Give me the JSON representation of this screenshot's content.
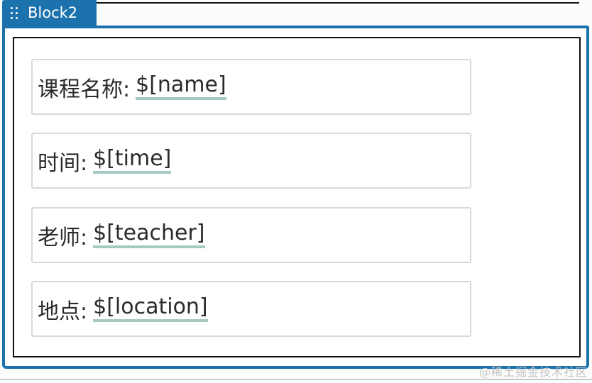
{
  "block": {
    "title": "Block2",
    "grip_icon": "grip-dots-icon",
    "accent_color": "#1b72ad"
  },
  "fields": [
    {
      "label": "课程名称:",
      "value": "$[name]"
    },
    {
      "label": "时间:",
      "value": "$[time]"
    },
    {
      "label": "老师:",
      "value": "$[teacher]"
    },
    {
      "label": "地点:",
      "value": "$[location]"
    }
  ],
  "watermark": "@稀土掘金技术社区"
}
